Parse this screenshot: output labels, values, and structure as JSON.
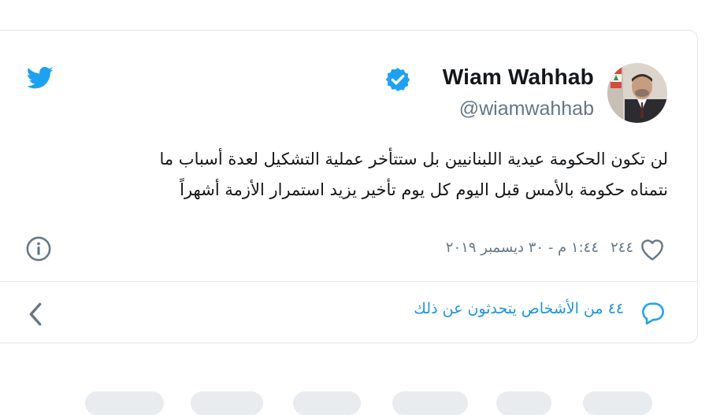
{
  "tweet": {
    "author": {
      "display_name": "Wiam Wahhab",
      "handle": "@wiamwahhab",
      "verified": true
    },
    "text_lines": [
      "لن تكون الحكومة عيدية اللبنانيين بل ستتأخر عملية التشكيل لعدة أسباب ما",
      "نتمناه حكومة بالأمس  قبل اليوم كل يوم تأخير يزيد استمرار الأزمة أشهراً"
    ],
    "like_count": "٢٤٤",
    "timestamp": "١:٤٤ م - ٣٠ ديسمبر ٢٠١٩",
    "conversation_text": "٤٤ من الأشخاص يتحدثون عن ذلك"
  },
  "icons": {
    "brand": "twitter-bird-icon",
    "verified": "verified-badge-icon",
    "info": "info-icon",
    "like": "heart-icon",
    "reply": "reply-bubble-icon",
    "nav": "chevron-left-icon"
  },
  "colors": {
    "twitter_blue": "#1da1f2",
    "link_blue": "#1b95e0",
    "text": "#14171a",
    "muted": "#657786",
    "border": "#e1e8ed"
  }
}
